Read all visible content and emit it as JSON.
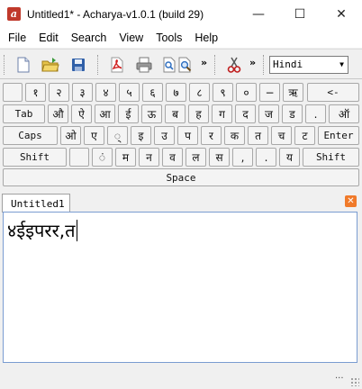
{
  "window": {
    "title": "Untitled1* - Acharya-v1.0.1 (build 29)",
    "app_icon_letter": "a",
    "controls": {
      "minimize": "—",
      "maximize": "☐",
      "close": "✕"
    }
  },
  "menu": [
    "File",
    "Edit",
    "Search",
    "View",
    "Tools",
    "Help"
  ],
  "toolbar": {
    "icons": [
      "new-file-icon",
      "open-folder-icon",
      "save-icon",
      "pdf-icon",
      "print-icon",
      "print-preview-icon",
      "find-icon",
      "cut-icon"
    ],
    "overflow": "»",
    "language": "Hindi"
  },
  "keyboard": {
    "row1": [
      "",
      "१",
      "२",
      "३",
      "४",
      "५",
      "६",
      "७",
      "८",
      "९",
      "०",
      "−",
      "ऋ",
      "<-"
    ],
    "row2": [
      "Tab",
      "औ",
      "ऐ",
      "आ",
      "ई",
      "ऊ",
      "ब",
      "ह",
      "ग",
      "द",
      "ज",
      "ड",
      ".",
      "ऑ"
    ],
    "row3": [
      "Caps",
      "ओ",
      "ए",
      "्",
      "इ",
      "उ",
      "प",
      "र",
      "क",
      "त",
      "च",
      "ट",
      "Enter"
    ],
    "row4": [
      "Shift",
      "",
      "ं",
      "म",
      "न",
      "व",
      "ल",
      "स",
      ",",
      ".",
      "य",
      "Shift"
    ],
    "space": "Space"
  },
  "tabs": [
    {
      "label": "Untitled1",
      "close": "✕"
    }
  ],
  "editor": {
    "content": "४ईइपरर,त"
  },
  "status": {
    "text": "..."
  },
  "colors": {
    "accent": "#c0392b",
    "tab_close": "#f07a2a",
    "editor_border": "#7a9cd1"
  }
}
